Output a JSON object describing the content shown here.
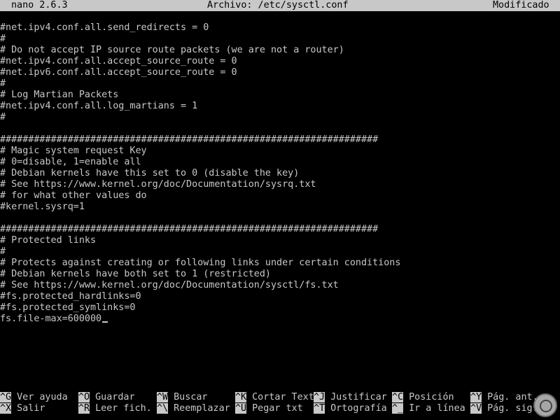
{
  "titlebar": {
    "app": "nano 2.6.3",
    "file": "Archivo: /etc/sysctl.conf",
    "status": "Modificado"
  },
  "editor_lines": [
    "#net.ipv4.conf.all.send_redirects = 0",
    "#",
    "# Do not accept IP source route packets (we are not a router)",
    "#net.ipv4.conf.all.accept_source_route = 0",
    "#net.ipv6.conf.all.accept_source_route = 0",
    "#",
    "# Log Martian Packets",
    "#net.ipv4.conf.all.log_martians = 1",
    "#",
    "",
    "###################################################################",
    "# Magic system request Key",
    "# 0=disable, 1=enable all",
    "# Debian kernels have this set to 0 (disable the key)",
    "# See https://www.kernel.org/doc/Documentation/sysrq.txt",
    "# for what other values do",
    "#kernel.sysrq=1",
    "",
    "###################################################################",
    "# Protected links",
    "#",
    "# Protects against creating or following links under certain conditions",
    "# Debian kernels have both set to 1 (restricted)",
    "# See https://www.kernel.org/doc/Documentation/sysctl/fs.txt",
    "#fs.protected_hardlinks=0",
    "#fs.protected_symlinks=0",
    "fs.file-max=600000"
  ],
  "shortcuts_row1": [
    {
      "key": "^G",
      "label": "Ver ayuda"
    },
    {
      "key": "^O",
      "label": "Guardar"
    },
    {
      "key": "^W",
      "label": "Buscar"
    },
    {
      "key": "^K",
      "label": "Cortar Text"
    },
    {
      "key": "^J",
      "label": "Justificar"
    },
    {
      "key": "^C",
      "label": "Posición"
    },
    {
      "key": "^Y",
      "label": "Pág. ant."
    }
  ],
  "shortcuts_row2": [
    {
      "key": "^X",
      "label": "Salir"
    },
    {
      "key": "^R",
      "label": "Leer fich."
    },
    {
      "key": "^\\",
      "label": "Reemplazar"
    },
    {
      "key": "^U",
      "label": "Pegar txt"
    },
    {
      "key": "^T",
      "label": "Ortografía"
    },
    {
      "key": "^_",
      "label": "Ir a línea"
    },
    {
      "key": "^V",
      "label": "Pág. sig."
    }
  ],
  "colors": {
    "background": "#000000",
    "foreground": "#c8c8c8",
    "inverse_bg": "#c8c8c8",
    "inverse_fg": "#000000"
  },
  "watermark_icon": "magnifier-logo-icon"
}
